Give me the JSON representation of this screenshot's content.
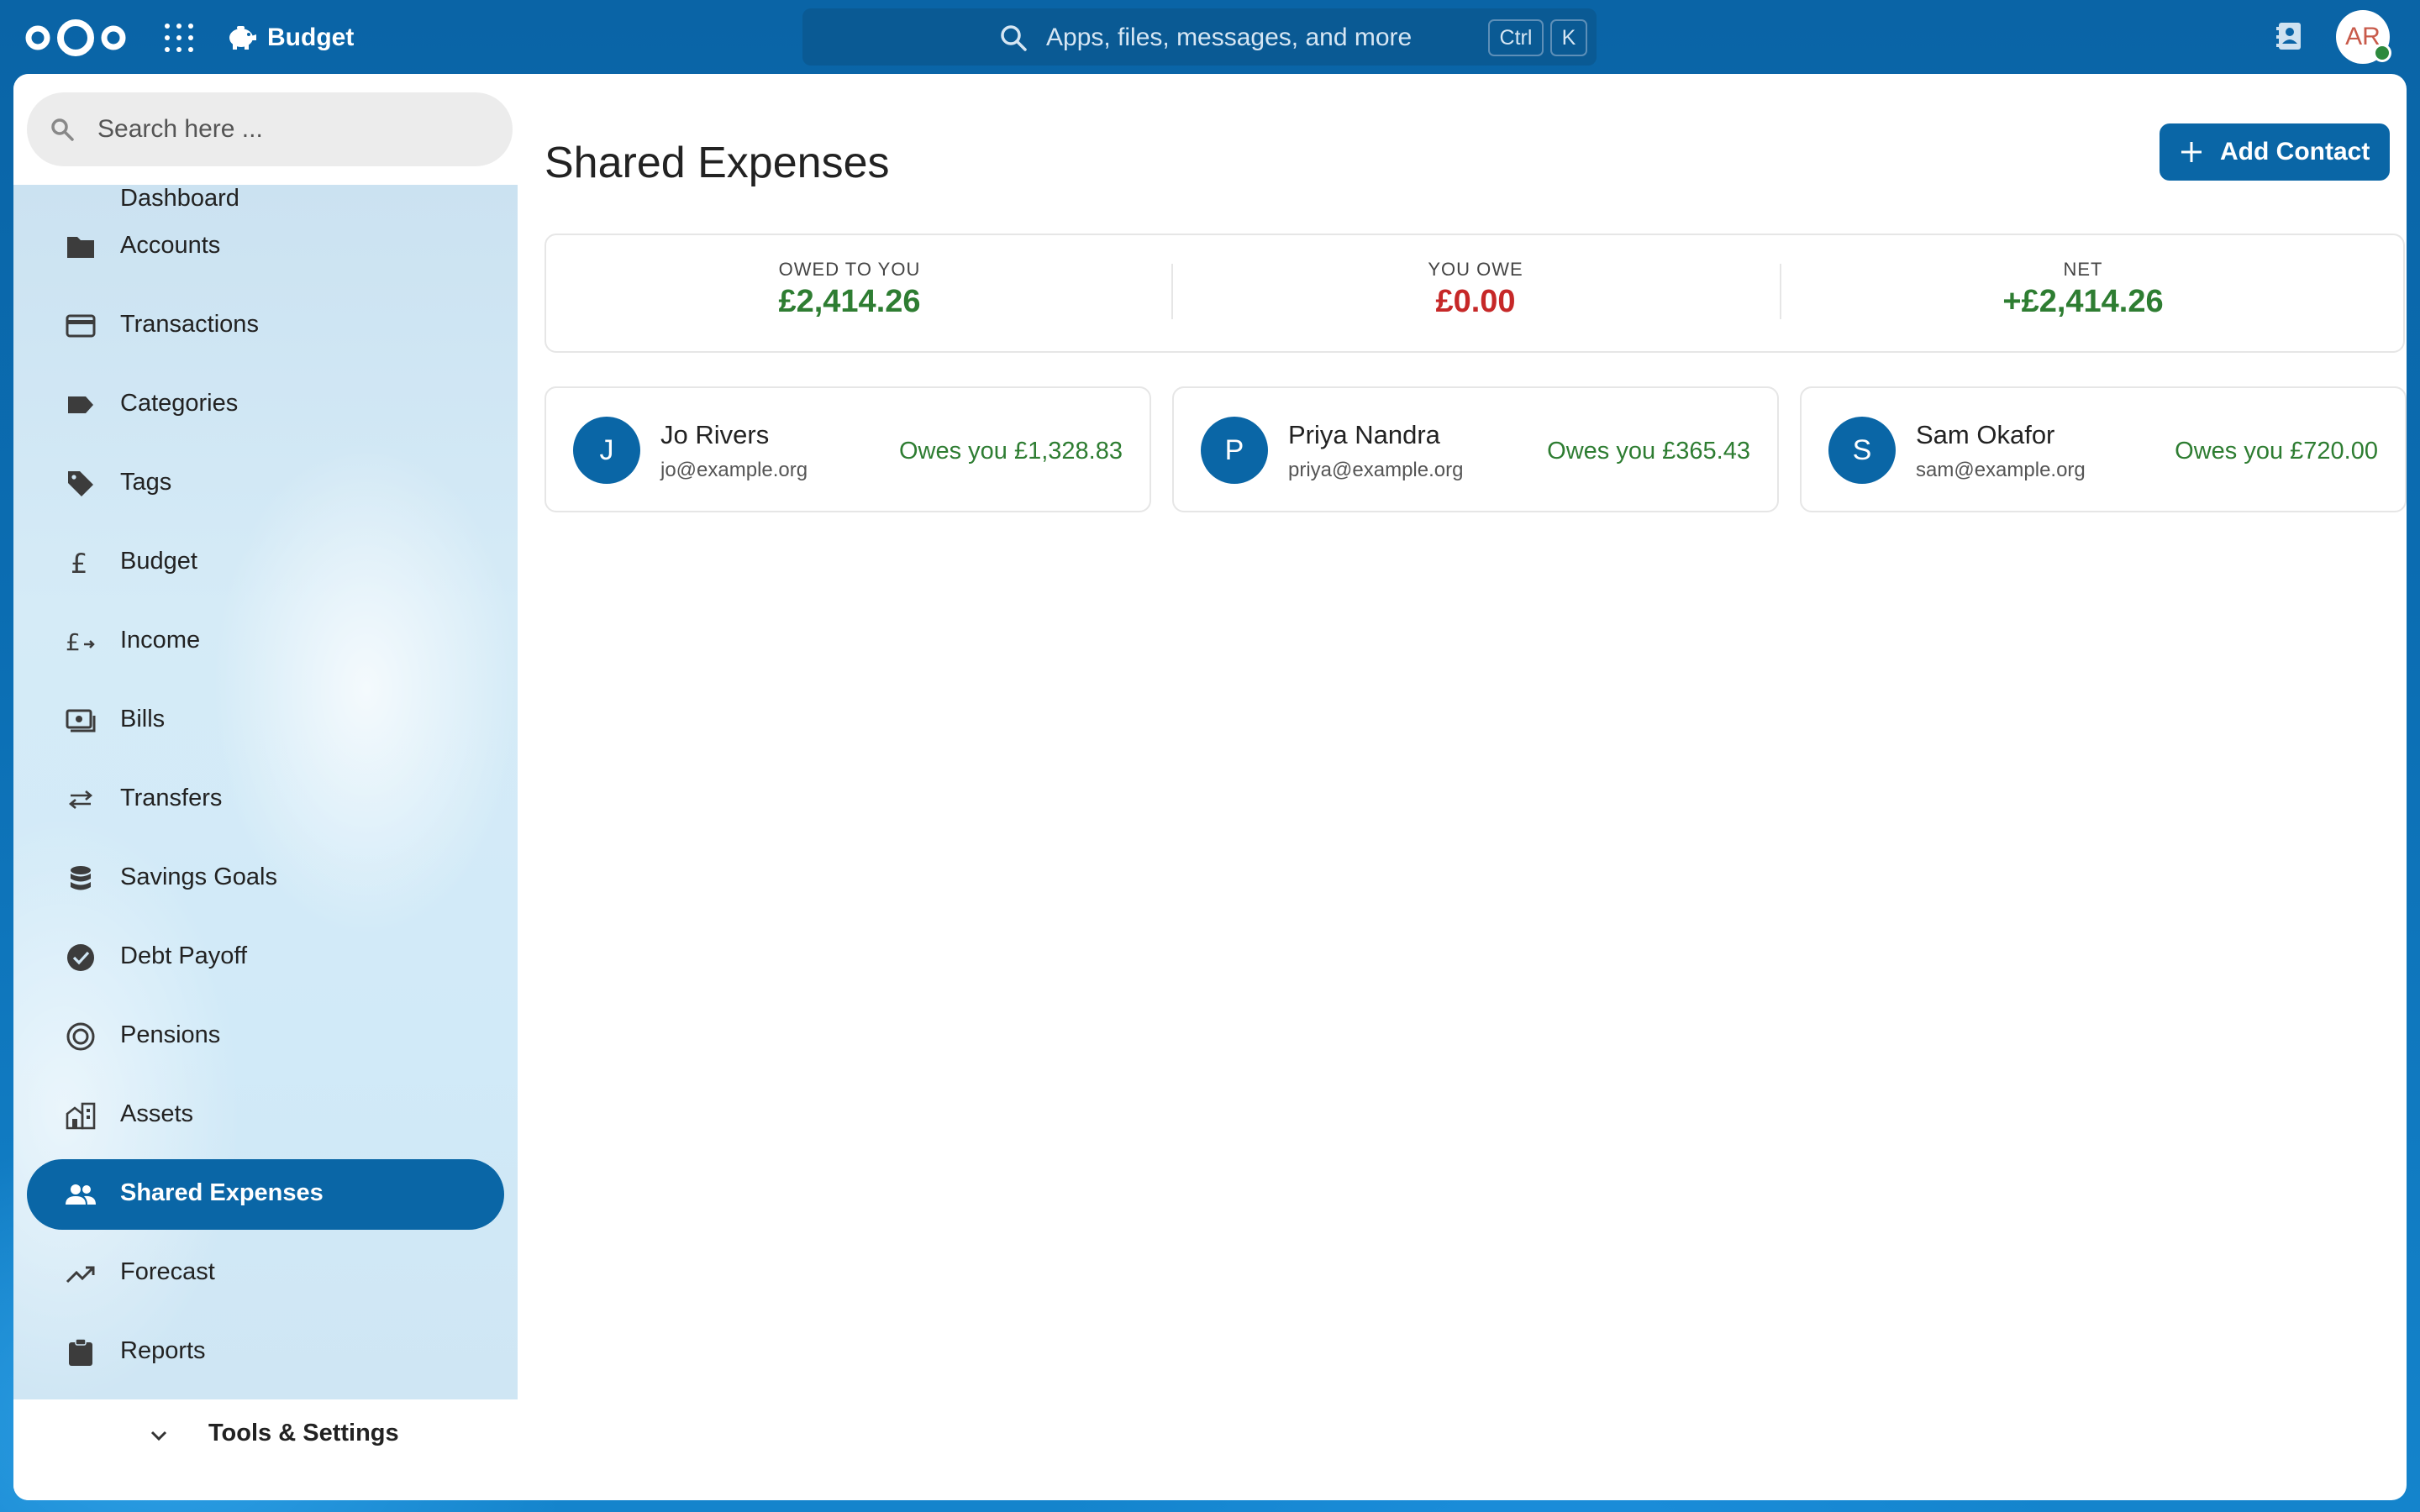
{
  "header": {
    "app_name": "Budget",
    "search_placeholder": "Apps, files, messages, and more",
    "shortcut_keys": [
      "Ctrl",
      "K"
    ],
    "user_initials": "AR"
  },
  "sidebar": {
    "search_placeholder": "Search here ...",
    "partial_item": "Dashboard",
    "items": [
      {
        "label": "Accounts",
        "icon": "folder-icon"
      },
      {
        "label": "Transactions",
        "icon": "credit-card-icon"
      },
      {
        "label": "Categories",
        "icon": "label-icon"
      },
      {
        "label": "Tags",
        "icon": "tag-icon"
      },
      {
        "label": "Budget",
        "icon": "pound-icon"
      },
      {
        "label": "Income",
        "icon": "pound-arrow-icon"
      },
      {
        "label": "Bills",
        "icon": "cash-icon"
      },
      {
        "label": "Transfers",
        "icon": "swap-icon"
      },
      {
        "label": "Savings Goals",
        "icon": "database-icon"
      },
      {
        "label": "Debt Payoff",
        "icon": "check-circle-icon"
      },
      {
        "label": "Pensions",
        "icon": "target-icon"
      },
      {
        "label": "Assets",
        "icon": "buildings-icon"
      },
      {
        "label": "Shared Expenses",
        "icon": "people-icon",
        "active": true
      },
      {
        "label": "Forecast",
        "icon": "trending-up-icon"
      },
      {
        "label": "Reports",
        "icon": "clipboard-icon"
      }
    ],
    "tools_label": "Tools & Settings"
  },
  "main": {
    "title": "Shared Expenses",
    "add_button": "Add Contact",
    "summary": {
      "owed_to_you_label": "OWED TO YOU",
      "owed_to_you": "£2,414.26",
      "you_owe_label": "YOU OWE",
      "you_owe": "£0.00",
      "net_label": "NET",
      "net": "+£2,414.26"
    },
    "contacts": [
      {
        "initial": "J",
        "name": "Jo Rivers",
        "email": "jo@example.org",
        "balance": "Owes you £1,328.83"
      },
      {
        "initial": "P",
        "name": "Priya Nandra",
        "email": "priya@example.org",
        "balance": "Owes you £365.43"
      },
      {
        "initial": "S",
        "name": "Sam Okafor",
        "email": "sam@example.org",
        "balance": "Owes you £720.00"
      }
    ]
  },
  "colors": {
    "primary": "#0a66a6",
    "positive": "#2e7d32",
    "negative": "#c62828"
  }
}
